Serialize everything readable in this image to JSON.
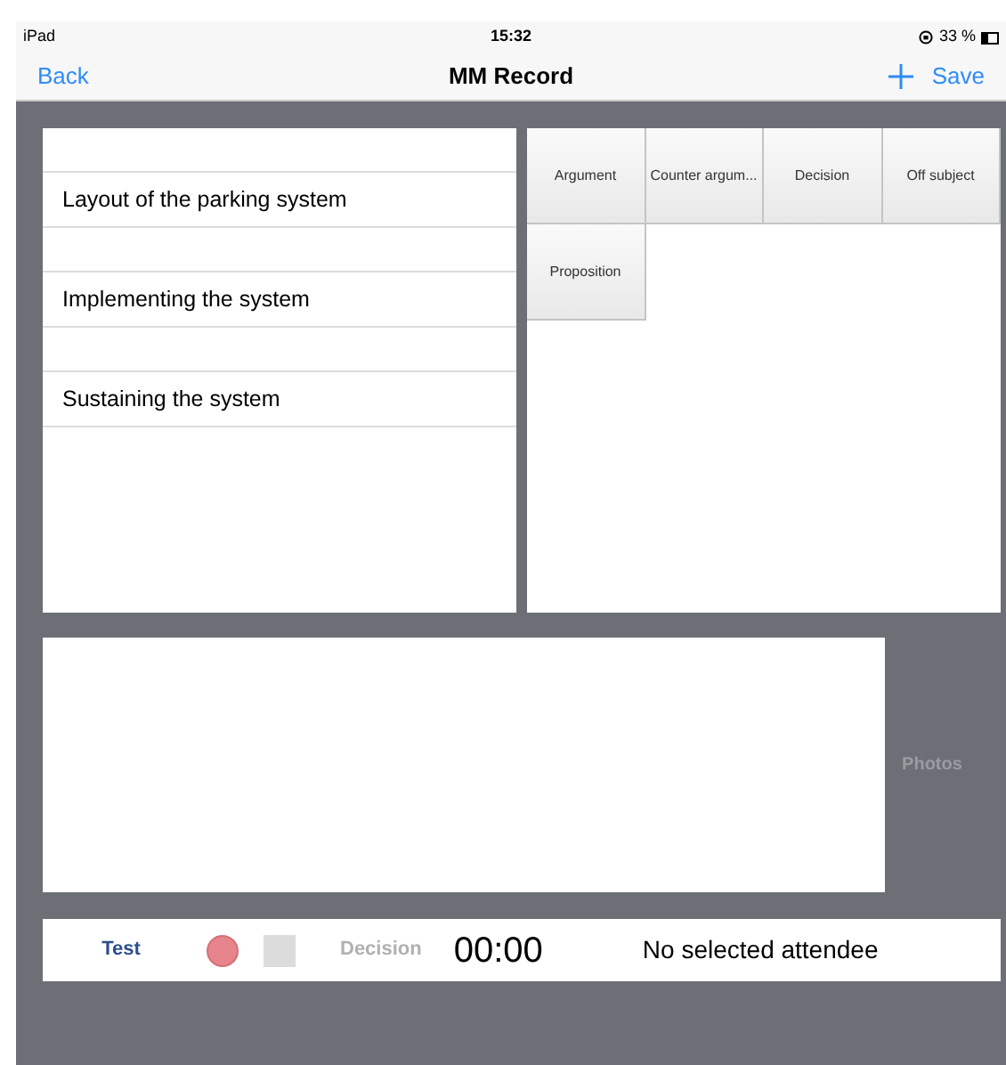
{
  "status_bar": {
    "device": "iPad",
    "time": "15:32",
    "battery": "33 %"
  },
  "nav_bar": {
    "back": "Back",
    "title": "MM Record",
    "save": "Save"
  },
  "topics": [
    {
      "label": "Layout of the parking system"
    },
    {
      "label": "Implementing the system"
    },
    {
      "label": "Sustaining the system"
    }
  ],
  "categories": [
    {
      "label": "Argument"
    },
    {
      "label": "Counter argum..."
    },
    {
      "label": "Decision"
    },
    {
      "label": "Off subject"
    },
    {
      "label": "Proposition"
    }
  ],
  "photos_label": "Photos",
  "recorder": {
    "name": "Test",
    "current_category": "Decision",
    "timer": "00:00",
    "attendee": "No selected attendee"
  }
}
